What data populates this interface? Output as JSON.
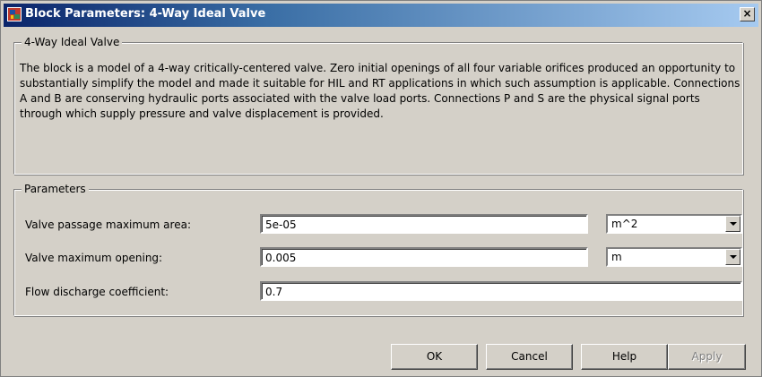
{
  "window": {
    "title": "Block Parameters: 4-Way Ideal Valve",
    "close_label": "×"
  },
  "description_group": {
    "legend": "4-Way Ideal Valve",
    "text": "The block is a model of a 4-way critically-centered valve. Zero initial openings of all four variable orifices produced an opportunity to substantially simplify the model and made it suitable for HIL and RT applications in which such assumption is applicable. Connections A and B are conserving hydraulic ports associated with the valve load ports. Connections P and S are the physical signal ports through which supply pressure and valve displacement is provided."
  },
  "parameters": {
    "legend": "Parameters",
    "rows": [
      {
        "label": "Valve passage maximum area:",
        "value": "5e-05",
        "unit": "m^2"
      },
      {
        "label": "Valve maximum opening:",
        "value": "0.005",
        "unit": "m"
      },
      {
        "label": "Flow discharge coefficient:",
        "value": "0.7"
      }
    ]
  },
  "buttons": {
    "ok": "OK",
    "cancel": "Cancel",
    "help": "Help",
    "apply": "Apply"
  },
  "icons": {
    "app_icon": "simulink-block-icon",
    "close_icon": "close-icon",
    "dropdown_icon": "chevron-down-icon"
  }
}
